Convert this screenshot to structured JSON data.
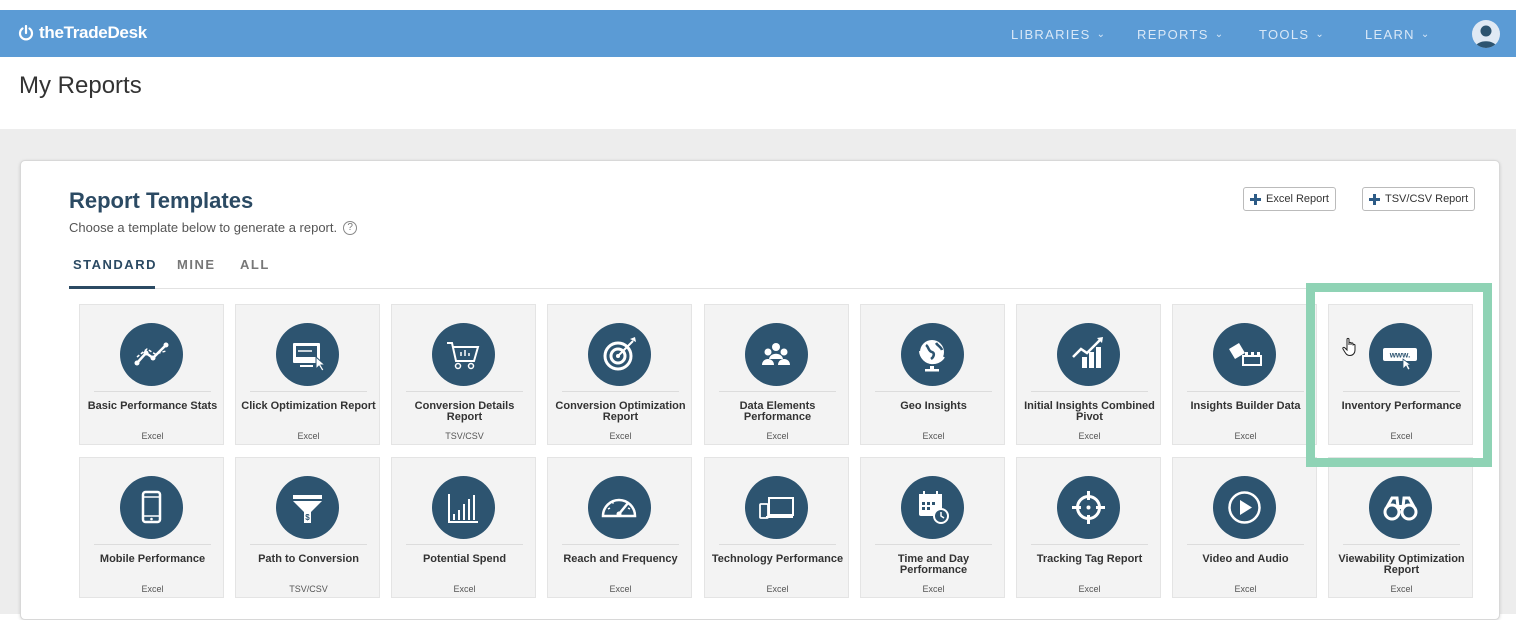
{
  "app": {
    "brand": "theTradeDesk"
  },
  "nav": [
    {
      "label": "LIBRARIES"
    },
    {
      "label": "REPORTS"
    },
    {
      "label": "TOOLS"
    },
    {
      "label": "LEARN"
    }
  ],
  "page": {
    "title": "My Reports"
  },
  "templates": {
    "title": "Report Templates",
    "subtitle": "Choose a template below to generate a report.",
    "help": "?",
    "tabs": [
      {
        "label": "STANDARD",
        "active": true
      },
      {
        "label": "MINE",
        "active": false
      },
      {
        "label": "ALL",
        "active": false
      }
    ],
    "buttons": {
      "excel": "Excel Report",
      "tsv": "TSV/CSV Report"
    },
    "rows": [
      [
        {
          "name": "Basic Performance Stats",
          "type": "Excel",
          "icon": "line-chart-icon"
        },
        {
          "name": "Click Optimization Report",
          "type": "Excel",
          "icon": "screen-click-icon"
        },
        {
          "name": "Conversion Details Report",
          "type": "TSV/CSV",
          "icon": "shopping-cart-icon"
        },
        {
          "name": "Conversion Optimization Report",
          "type": "Excel",
          "icon": "target-icon"
        },
        {
          "name": "Data Elements Performance",
          "type": "Excel",
          "icon": "people-group-icon"
        },
        {
          "name": "Geo Insights",
          "type": "Excel",
          "icon": "globe-icon"
        },
        {
          "name": "Initial Insights Combined Pivot",
          "type": "Excel",
          "icon": "growth-chart-icon"
        },
        {
          "name": "Insights Builder Data",
          "type": "Excel",
          "icon": "building-blocks-icon"
        },
        {
          "name": "Inventory Performance",
          "type": "Excel",
          "icon": "www-icon"
        }
      ],
      [
        {
          "name": "Mobile Performance",
          "type": "Excel",
          "icon": "mobile-phone-icon"
        },
        {
          "name": "Path to Conversion",
          "type": "TSV/CSV",
          "icon": "funnel-icon"
        },
        {
          "name": "Potential Spend",
          "type": "Excel",
          "icon": "bar-chart-icon"
        },
        {
          "name": "Reach and Frequency",
          "type": "Excel",
          "icon": "speedometer-icon"
        },
        {
          "name": "Technology Performance",
          "type": "Excel",
          "icon": "devices-icon"
        },
        {
          "name": "Time and Day Performance",
          "type": "Excel",
          "icon": "calendar-clock-icon"
        },
        {
          "name": "Tracking Tag Report",
          "type": "Excel",
          "icon": "crosshair-icon"
        },
        {
          "name": "Video and Audio",
          "type": "Excel",
          "icon": "play-icon"
        },
        {
          "name": "Viewability Optimization Report",
          "type": "Excel",
          "icon": "binoculars-icon"
        }
      ]
    ]
  },
  "colors": {
    "header": "#5b9bd5",
    "icon_circle": "#2d5470",
    "highlight": "#8fd3b5",
    "title": "#2b4a63"
  }
}
